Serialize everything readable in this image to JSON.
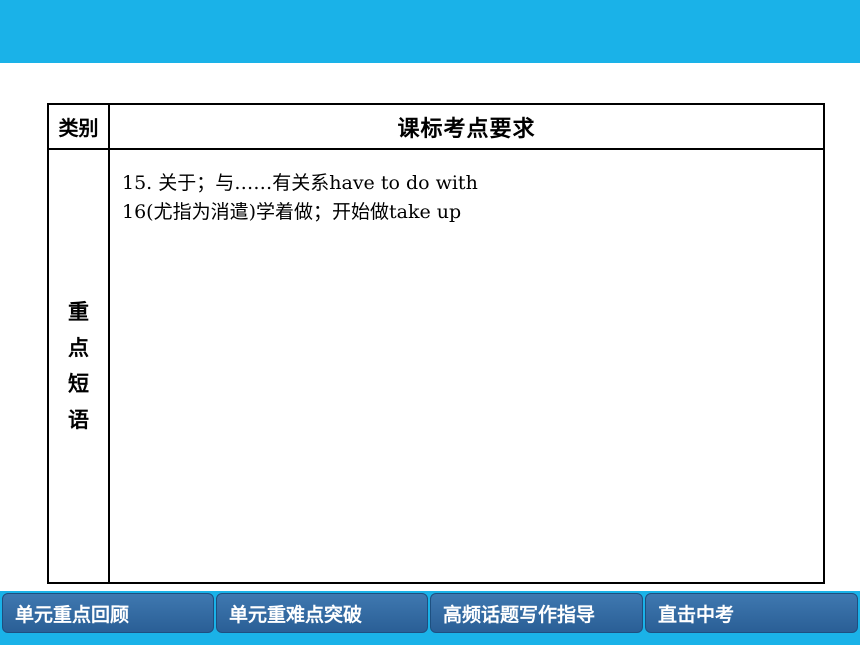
{
  "table": {
    "header_category": "类别",
    "header_requirement": "课标考点要求",
    "category": [
      "重",
      "点",
      "短",
      "语"
    ],
    "lines": [
      "15. 关于；与……有关系have to do with",
      "16(尤指为消遣)学着做；开始做take up"
    ]
  },
  "nav": {
    "tabs": [
      "单元重点回顾",
      "单元重难点突破",
      "高频话题写作指导",
      "直击中考"
    ]
  },
  "colors": {
    "banner": "#1ab2e8",
    "tab": "#2f6aa3"
  }
}
